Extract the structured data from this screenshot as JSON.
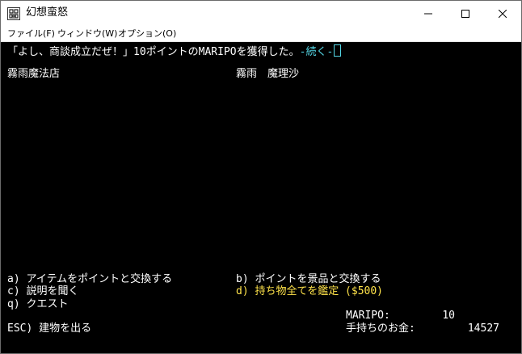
{
  "window": {
    "title": "幻想蛮怒",
    "controls": {
      "minimize": "—",
      "maximize": "☐",
      "close": "✕"
    }
  },
  "menu": [
    {
      "label": "ファイル(F)"
    },
    {
      "label": "ウィンドウ(W)"
    },
    {
      "label": "オプション(O)"
    }
  ],
  "console": {
    "message": "「よし、商談成立だぜ！」10ポイントのMARIPOを獲得した。",
    "more_prompt": "-続く-",
    "shop_name": "霧雨魔法店",
    "owner_name": "霧雨　魔理沙",
    "options": {
      "a": "a) アイテムをポイントと交換する",
      "b": "b) ポイントを景品と交換する",
      "c": "c) 説明を聞く",
      "d": "d) 持ち物全てを鑑定 ($500)",
      "q": "q) クエスト",
      "esc": "ESC) 建物を出る"
    },
    "status": {
      "maripo_label": "MARIPO:",
      "maripo_value": "10",
      "gold_label": "手持ちのお金:",
      "gold_value": "14527"
    }
  },
  "colors": {
    "background": "#000000",
    "text": "#ffffff",
    "highlight_cyan": "#55d7e6",
    "highlight_yellow": "#ffe34a"
  }
}
